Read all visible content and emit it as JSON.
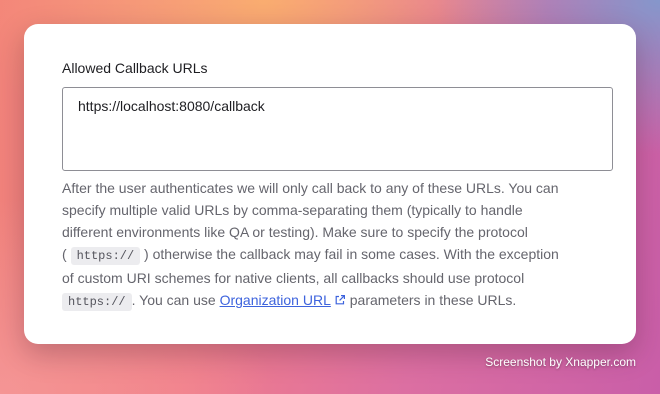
{
  "field": {
    "label": "Allowed Callback URLs",
    "value": "https://localhost:8080/callback"
  },
  "help": {
    "line1": "After the user authenticates we will only call back to any of these URLs. You can",
    "line2": "specify multiple valid URLs by comma-separating them (typically to handle",
    "line3": "different environments like QA or testing). Make sure to specify the protocol",
    "line4_open": "( ",
    "code1": "https://",
    "line4_rest": " ) otherwise the callback may fail in some cases. With the exception",
    "line5": "of custom URI schemes for native clients, all callbacks should use protocol",
    "code2": "https://",
    "line6_mid": ". You can use ",
    "link": "Organization URL",
    "link_icon": "external-link-icon",
    "line6_end": " parameters in these URLs."
  },
  "watermark": "Screenshot by Xnapper.com",
  "colors": {
    "link": "#3d63dd",
    "text": "#65656d",
    "label": "#1e1e22"
  }
}
